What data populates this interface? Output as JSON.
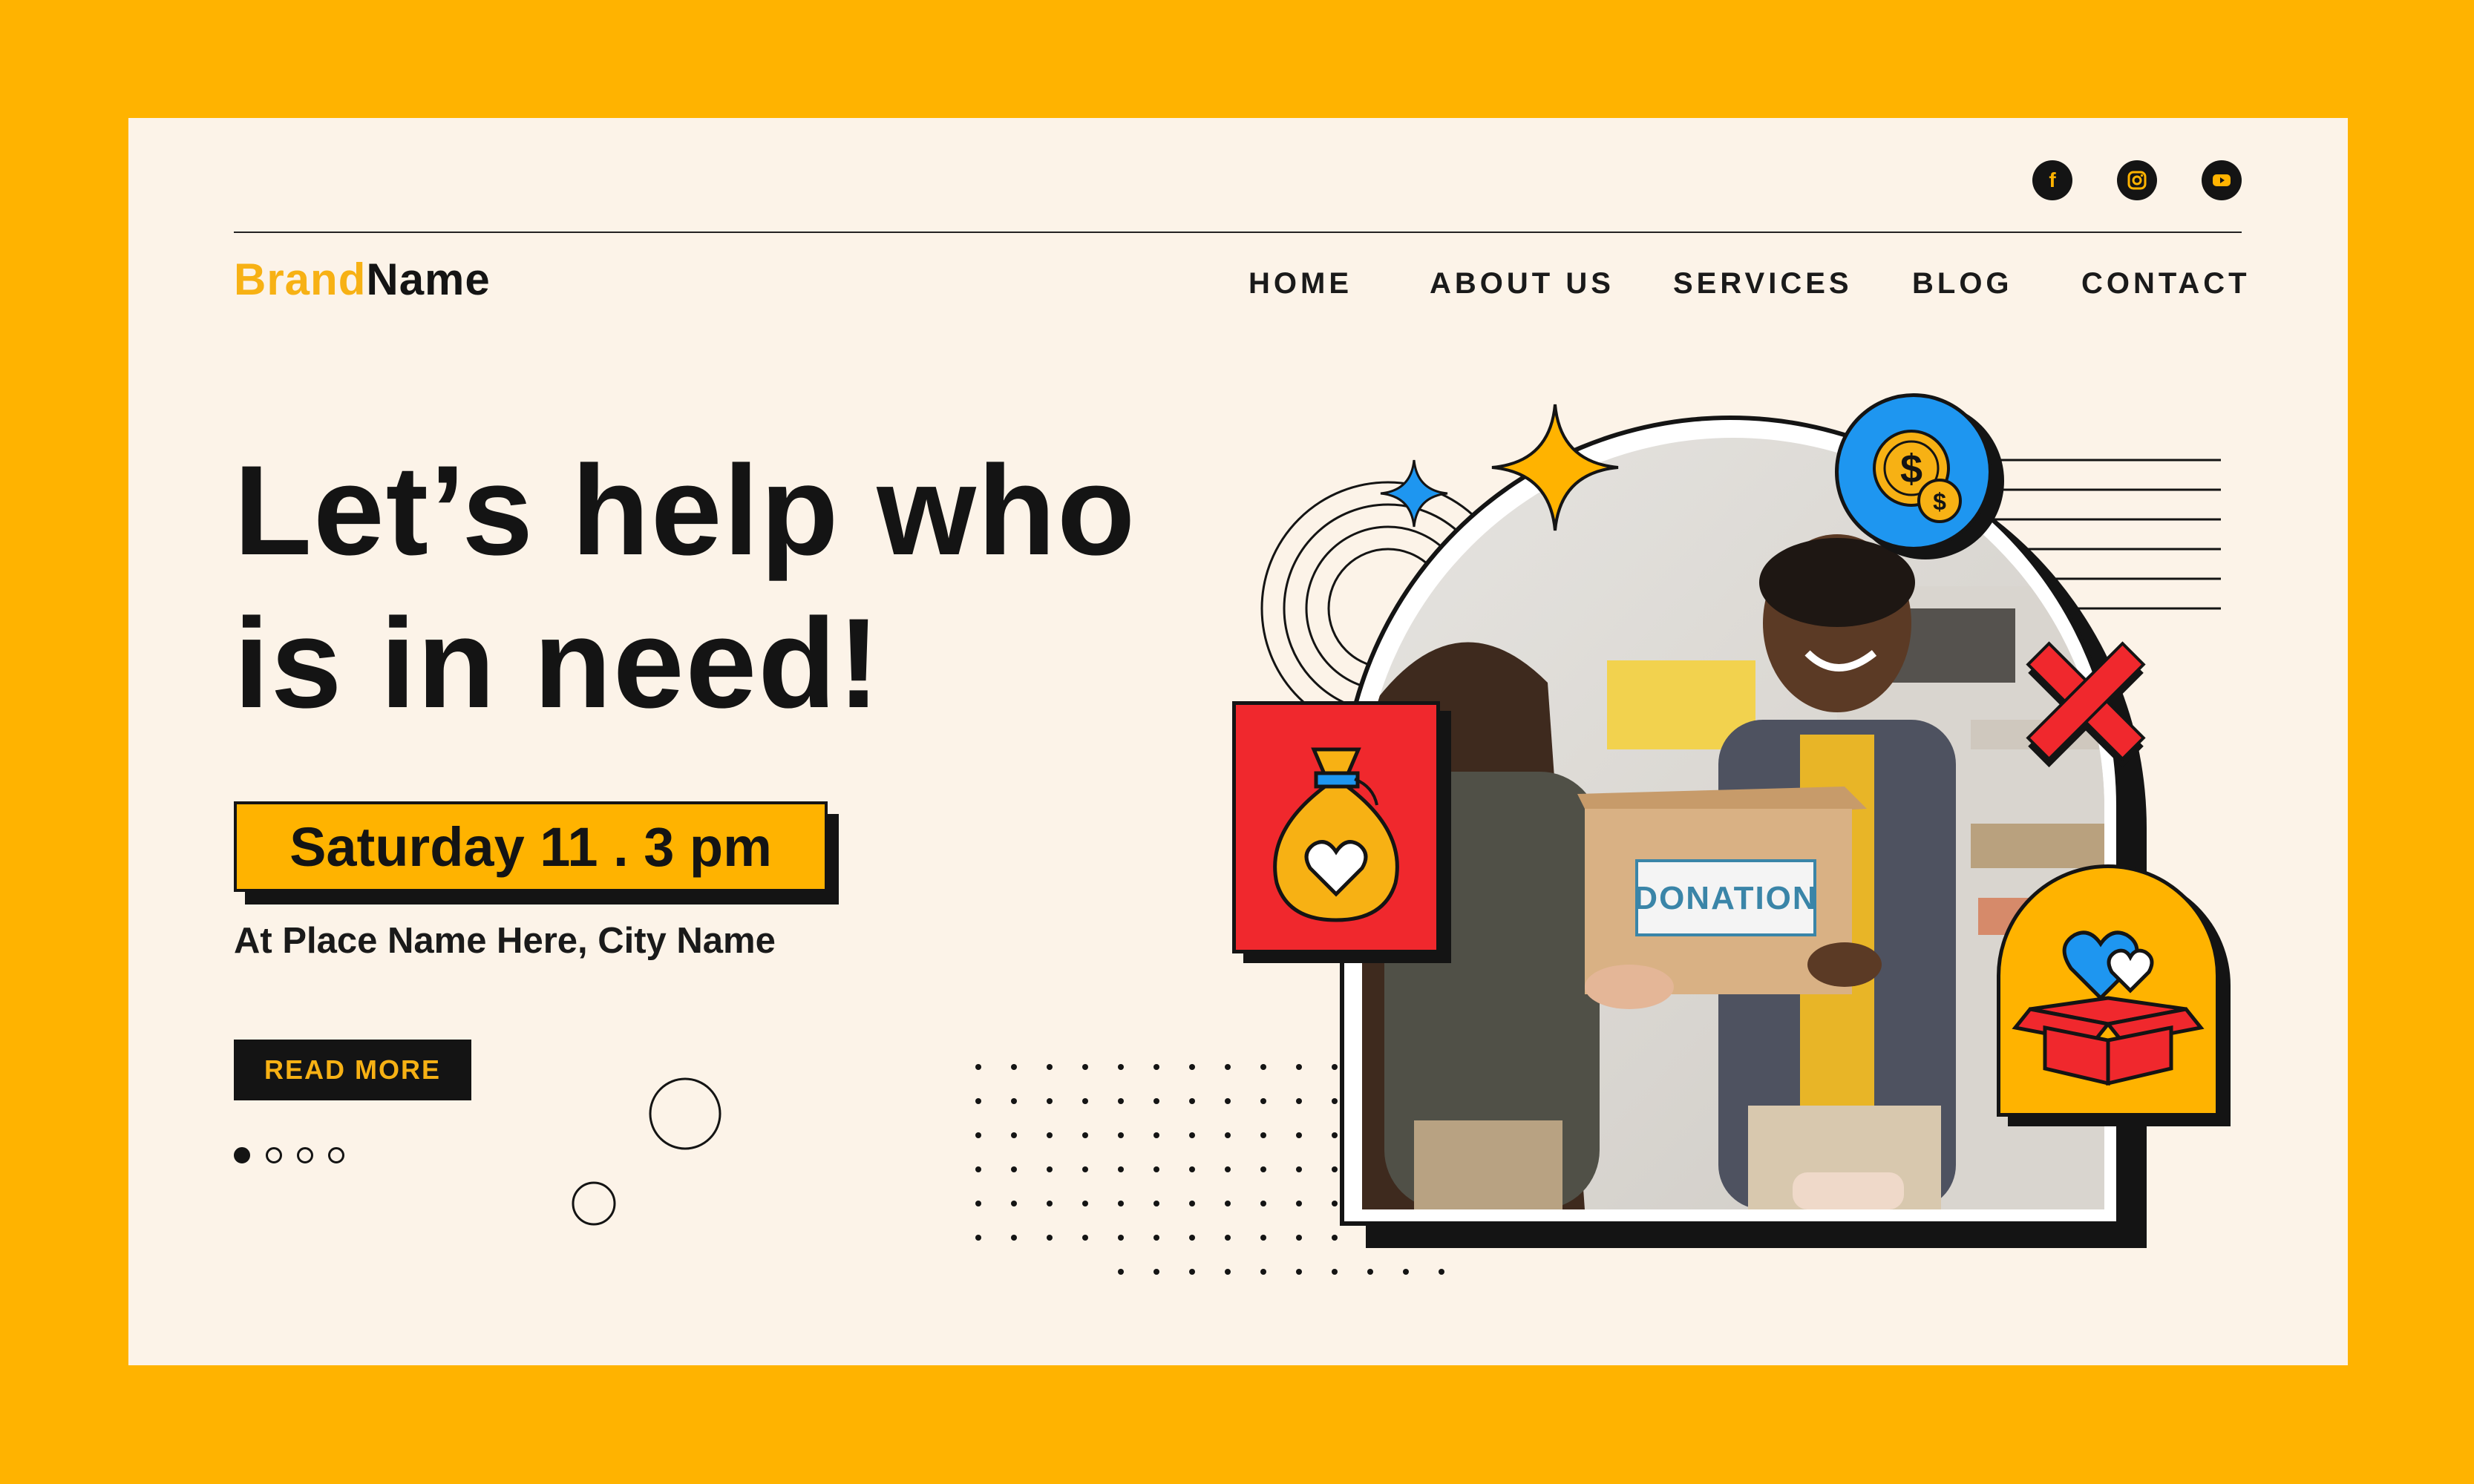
{
  "brand": {
    "part1": "Brand",
    "part2": "Name"
  },
  "social": [
    {
      "icon": "facebook-icon",
      "glyph": "f"
    },
    {
      "icon": "instagram-icon",
      "glyph": ""
    },
    {
      "icon": "youtube-icon",
      "glyph": ""
    }
  ],
  "nav": {
    "home": "HOME",
    "about": "ABOUT US",
    "services": "SERVICES",
    "blog": "BLOG",
    "contact": "CONTACT"
  },
  "hero": {
    "headline_line1": "Let’s help who",
    "headline_line2": "is in need!",
    "date": "Saturday 11 . 3 pm",
    "place": "At Place Name Here, City Name",
    "read_more": "READ MORE",
    "box_label": "DONATION"
  },
  "slider": {
    "total": 4,
    "active": 1
  },
  "colors": {
    "frame": "#FFB300",
    "page": "#FCF3E8",
    "dark": "#141414",
    "brand_yellow": "#F7B114",
    "accent_red": "#F0282D",
    "accent_blue": "#1E96F0"
  }
}
